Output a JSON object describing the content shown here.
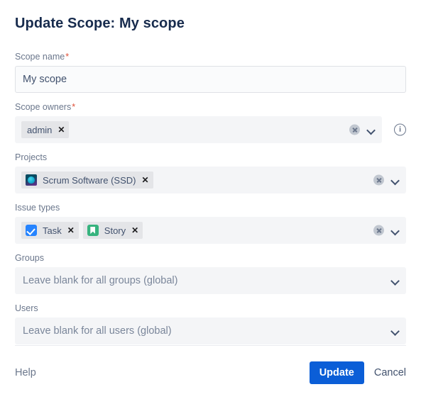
{
  "page": {
    "title": "Update Scope: My scope"
  },
  "fields": {
    "scope_name": {
      "label": "Scope name",
      "required_marker": "*",
      "value": "My scope",
      "placeholder": ""
    },
    "scope_owners": {
      "label": "Scope owners",
      "required_marker": "*",
      "chips": [
        {
          "label": "admin",
          "remove": "✕",
          "icon": "none"
        }
      ],
      "clear_icon": "clear-icon",
      "chevron_icon": "chevron-down-icon",
      "info_icon": "info-icon",
      "info_glyph": "i"
    },
    "projects": {
      "label": "Projects",
      "chips": [
        {
          "label": "Scrum Software (SSD)",
          "remove": "✕",
          "icon": "project-avatar-icon"
        }
      ],
      "clear_icon": "clear-icon",
      "chevron_icon": "chevron-down-icon"
    },
    "issue_types": {
      "label": "Issue types",
      "chips": [
        {
          "label": "Task",
          "remove": "✕",
          "icon": "task-icon"
        },
        {
          "label": "Story",
          "remove": "✕",
          "icon": "story-icon"
        }
      ],
      "clear_icon": "clear-icon",
      "chevron_icon": "chevron-down-icon"
    },
    "groups": {
      "label": "Groups",
      "placeholder": "Leave blank for all groups (global)",
      "chevron_icon": "chevron-down-icon"
    },
    "users": {
      "label": "Users",
      "placeholder": "Leave blank for all users (global)",
      "chevron_icon": "chevron-down-icon"
    }
  },
  "footer": {
    "help_label": "Help",
    "update_label": "Update",
    "cancel_label": "Cancel"
  },
  "colors": {
    "title": "#172B4D",
    "label": "#6B778C",
    "required": "#DE4F38",
    "field_bg": "#F4F5F7",
    "input_bg": "#FAFBFC",
    "input_border": "#DFE1E6",
    "chip_bg": "#E4E5E8",
    "primary_button": "#0B5ED7",
    "task_icon": "#2684FF",
    "story_icon": "#36B37E",
    "divider": "#EBECF0"
  }
}
